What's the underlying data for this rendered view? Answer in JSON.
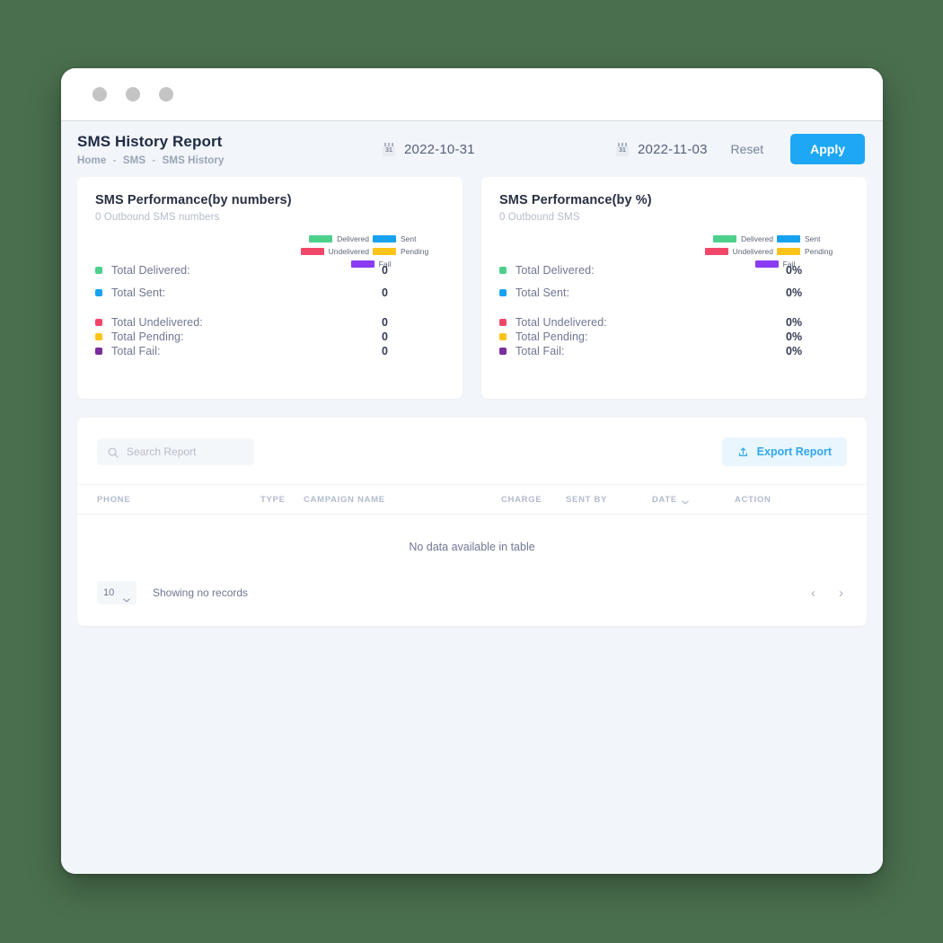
{
  "window": {
    "dots": [
      "traffic-light-1",
      "traffic-light-2",
      "traffic-light-3"
    ]
  },
  "header": {
    "title": "SMS History Report",
    "breadcrumb": [
      "Home",
      "SMS",
      "SMS History"
    ],
    "breadcrumb_separator": "-",
    "date_from": "2022-10-31",
    "date_to": "2022-11-03",
    "calendar_icon_day": "31",
    "reset_label": "Reset",
    "apply_label": "Apply"
  },
  "colors": {
    "accent": "#1ea7f5",
    "delivered": "#4dd08c",
    "sent": "#17a2f0",
    "undelivered": "#f2476b",
    "pending": "#fcc419",
    "fail": "#7b2d9e",
    "fail_swatch": "#8b3cf2",
    "page_background": "#f2f5f9",
    "desktop_background": "#4a6f4e"
  },
  "cards": [
    {
      "title": "SMS Performance(by numbers)",
      "subtitle": "0 Outbound SMS numbers",
      "legend": [
        {
          "label": "Delivered",
          "color": "#4dd08c"
        },
        {
          "label": "Sent",
          "color": "#17a2f0"
        },
        {
          "label": "Undelivered",
          "color": "#f2476b"
        },
        {
          "label": "Pending",
          "color": "#fcc419"
        },
        {
          "label": "Fail",
          "color": "#8b3cf2"
        }
      ],
      "stats": [
        {
          "label": "Total Delivered:",
          "value": "0",
          "color": "#4dd08c"
        },
        {
          "label": "Total Sent:",
          "value": "0",
          "color": "#17a2f0"
        },
        {
          "label": "Total Undelivered:",
          "value": "0",
          "color": "#f2476b"
        },
        {
          "label": "Total Pending:",
          "value": "0",
          "color": "#fcc419"
        },
        {
          "label": "Total Fail:",
          "value": "0",
          "color": "#7b2d9e"
        }
      ]
    },
    {
      "title": "SMS Performance(by %)",
      "subtitle": "0 Outbound SMS",
      "legend": [
        {
          "label": "Delivered",
          "color": "#4dd08c"
        },
        {
          "label": "Sent",
          "color": "#17a2f0"
        },
        {
          "label": "Undelivered",
          "color": "#f2476b"
        },
        {
          "label": "Pending",
          "color": "#fcc419"
        },
        {
          "label": "Fail",
          "color": "#8b3cf2"
        }
      ],
      "stats": [
        {
          "label": "Total Delivered:",
          "value": "0%",
          "color": "#4dd08c"
        },
        {
          "label": "Total Sent:",
          "value": "0%",
          "color": "#17a2f0"
        },
        {
          "label": "Total Undelivered:",
          "value": "0%",
          "color": "#f2476b"
        },
        {
          "label": "Total Pending:",
          "value": "0%",
          "color": "#fcc419"
        },
        {
          "label": "Total Fail:",
          "value": "0%",
          "color": "#7b2d9e"
        }
      ]
    }
  ],
  "table": {
    "search_placeholder": "Search Report",
    "search_value": "",
    "export_label": "Export Report",
    "columns": [
      "PHONE",
      "TYPE",
      "CAMPAIGN NAME",
      "CHARGE",
      "SENT BY",
      "DATE",
      "ACTION"
    ],
    "sorted_column": "DATE",
    "empty_message": "No data available in table",
    "page_size": "10",
    "showing_text": "Showing no records",
    "prev_label": "‹",
    "next_label": "›"
  }
}
